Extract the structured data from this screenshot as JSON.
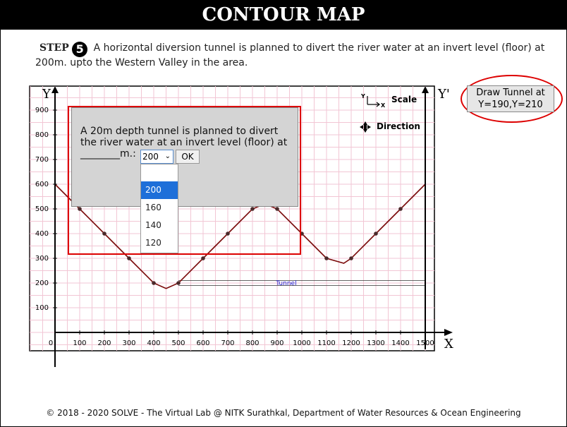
{
  "header": {
    "title": "CONTOUR MAP"
  },
  "step": {
    "label": "STEP",
    "number": "5",
    "text_line1": "A horizontal diversion tunnel is planned to divert the river water at an invert level (floor) at",
    "text_line2": "200m. upto the Western Valley in the area."
  },
  "plot": {
    "y_axis_label": "Y",
    "y_prime_label": "Y'",
    "x_axis_label": "X",
    "origin_label": "0",
    "x_ticks": [
      "100",
      "200",
      "300",
      "400",
      "500",
      "600",
      "700",
      "800",
      "900",
      "1000",
      "1100",
      "1200",
      "1300",
      "1400",
      "1500"
    ],
    "y_ticks": [
      "100",
      "200",
      "300",
      "400",
      "500",
      "600",
      "700",
      "800",
      "900"
    ],
    "scale_label": "Scale",
    "direction_label": "Direction",
    "tunnel_label": "Tunnel",
    "colors": {
      "grid": "#f2c6d4",
      "profile": "#7a0a0a",
      "axis": "#000000",
      "tunnel_label": "#1a1ad0"
    },
    "profile_points": [
      [
        0,
        600
      ],
      [
        100,
        500
      ],
      [
        200,
        400
      ],
      [
        300,
        300
      ],
      [
        400,
        200
      ],
      [
        450,
        178
      ],
      [
        500,
        200
      ],
      [
        600,
        300
      ],
      [
        700,
        400
      ],
      [
        800,
        500
      ],
      [
        850,
        520
      ],
      [
        900,
        500
      ],
      [
        1000,
        400
      ],
      [
        1100,
        300
      ],
      [
        1170,
        280
      ],
      [
        1200,
        300
      ],
      [
        1300,
        400
      ],
      [
        1400,
        500
      ],
      [
        1500,
        600
      ]
    ],
    "markers": [
      [
        100,
        500
      ],
      [
        200,
        400
      ],
      [
        300,
        300
      ],
      [
        400,
        200
      ],
      [
        500,
        200
      ],
      [
        600,
        300
      ],
      [
        700,
        400
      ],
      [
        800,
        500
      ],
      [
        900,
        500
      ],
      [
        1000,
        400
      ],
      [
        1100,
        300
      ],
      [
        1200,
        300
      ],
      [
        1300,
        400
      ],
      [
        1400,
        500
      ]
    ]
  },
  "draw_tunnel_button": {
    "label_line1": "Draw Tunnel at",
    "label_line2": "Y=190,Y=210"
  },
  "dialog": {
    "text_line1": "A 20m depth tunnel is planned to divert",
    "text_line2": "the river water at an invert level (floor) at",
    "text_line3": "________m.:",
    "select_value": "200",
    "ok_label": "OK",
    "options": [
      "200",
      "160",
      "140",
      "120"
    ]
  },
  "footer": {
    "text": "© 2018 - 2020 SOLVE - The Virtual Lab @ NITK Surathkal, Department of Water Resources & Ocean Engineering"
  }
}
